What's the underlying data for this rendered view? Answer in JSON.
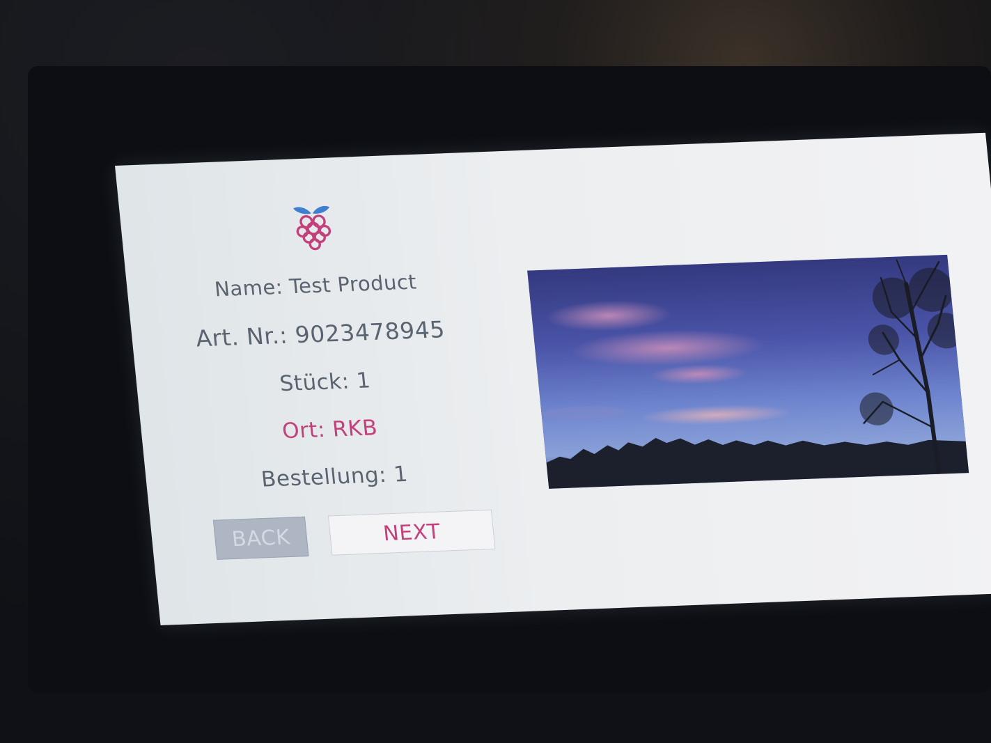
{
  "product": {
    "name": "Name: Test Product",
    "art_nr": "Art. Nr.: 9023478945",
    "stueck": "Stück: 1",
    "ort": "Ort: RKB",
    "bestellung": "Bestellung: 1"
  },
  "buttons": {
    "back_label": "BACK",
    "next_label": "NEXT"
  },
  "icons": {
    "logo": "raspberry-icon"
  },
  "colors": {
    "accent": "#c3417a",
    "text": "#5a6470",
    "leaf": "#3f7fd0",
    "background": "#eceef0"
  }
}
